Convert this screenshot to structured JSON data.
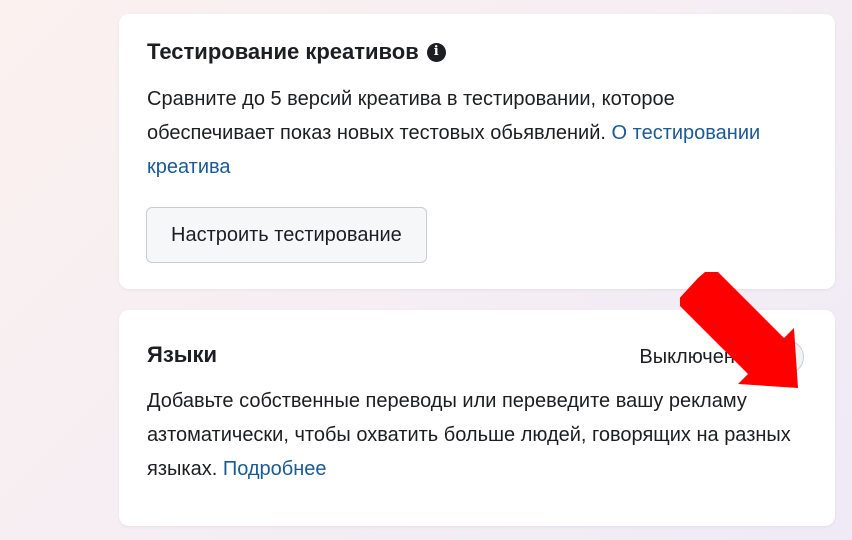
{
  "creative_testing": {
    "title": "Тестирование креативов",
    "info_icon": "info-icon",
    "description": "Сравните до 5 версий креатива в тестировании, которое обеспечивает показ новых тестовых обьявлений.",
    "link_label": "О тестировании креатива",
    "button_label": "Настроить тестирование"
  },
  "languages": {
    "title": "Языки",
    "toggle_status": "Выключено",
    "toggle_on": false,
    "description": "Добавьте собственные переводы или переведите вашу рекламу азтоматически, чтобы охватить больше людей, говорящих на разных языках.",
    "link_label": "Подробнее"
  },
  "annotation": {
    "arrow_icon": "red-arrow-icon",
    "arrow_color": "#ff0000"
  },
  "colors": {
    "link": "#1a5a96",
    "text": "#1c1e21",
    "card_bg": "#ffffff"
  }
}
